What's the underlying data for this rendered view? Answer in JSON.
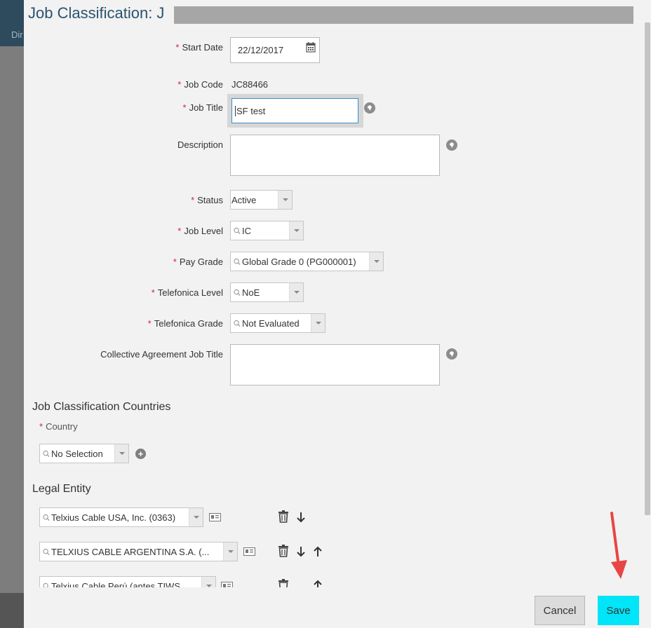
{
  "background": {
    "nav_text": "Dir"
  },
  "dialog": {
    "title": "Job Classification: J",
    "fields": {
      "start_date": {
        "label": "Start Date",
        "value": "22/12/2017",
        "required": true
      },
      "job_code": {
        "label": "Job Code",
        "value": "JC88466",
        "required": true
      },
      "job_title": {
        "label": "Job Title",
        "value": "SF test",
        "required": true
      },
      "description": {
        "label": "Description",
        "value": ""
      },
      "status": {
        "label": "Status",
        "value": "Active",
        "required": true
      },
      "job_level": {
        "label": "Job Level",
        "value": "IC",
        "required": true
      },
      "pay_grade": {
        "label": "Pay Grade",
        "value": "Global Grade 0 (PG000001)",
        "required": true
      },
      "telefonica_level": {
        "label": "Telefonica Level",
        "value": "NoE",
        "required": true
      },
      "telefonica_grade": {
        "label": "Telefonica Grade",
        "value": "Not Evaluated",
        "required": true
      },
      "collective_agreement": {
        "label": "Collective Agreement Job Title",
        "value": ""
      }
    },
    "countries_section": {
      "heading": "Job Classification Countries",
      "country_label": "Country",
      "country_value": "No Selection"
    },
    "legal_entity_section": {
      "heading": "Legal Entity",
      "entities": [
        "Telxius Cable USA, Inc. (0363)",
        "TELXIUS CABLE ARGENTINA S.A. (...",
        "Telxius Cable Perú (antes TIWS..."
      ]
    },
    "buttons": {
      "cancel": "Cancel",
      "save": "Save"
    }
  },
  "colors": {
    "title": "#2a5470",
    "required": "#d0263b",
    "save_button": "#00e5f7",
    "annotation_arrow": "#e84545"
  },
  "icons": [
    "calendar-icon",
    "globe-icon",
    "search-icon",
    "chevron-down-icon",
    "plus-icon",
    "card-icon",
    "trash-icon",
    "arrow-down-icon",
    "arrow-up-icon"
  ]
}
